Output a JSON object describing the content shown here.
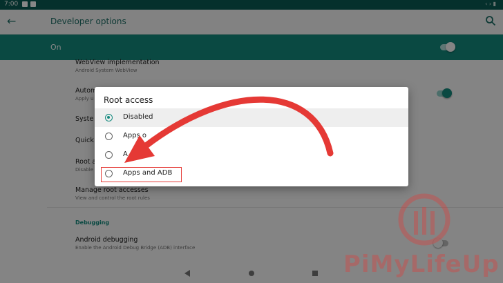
{
  "status_bar": {
    "time": "7:00"
  },
  "app_bar": {
    "title": "Developer options"
  },
  "master_switch": {
    "label": "On",
    "state": "on"
  },
  "settings": {
    "webview": {
      "title": "WebView implementation",
      "summary": "Android System WebView"
    },
    "auto": {
      "title": "Autom",
      "summary": "Apply u"
    },
    "system": {
      "title": "Syste"
    },
    "quick": {
      "title": "Quick"
    },
    "root": {
      "title": "Root a",
      "summary": "Disable"
    },
    "manage_root": {
      "title": "Manage root accesses",
      "summary": "View and control the root rules"
    },
    "debugging_header": "Debugging",
    "android_debugging": {
      "title": "Android debugging",
      "summary": "Enable the Android Debug Bridge (ADB) interface"
    }
  },
  "dialog": {
    "title": "Root access",
    "options": [
      {
        "label": "Disabled",
        "selected": true
      },
      {
        "label": "Apps o",
        "selected": false
      },
      {
        "label": "A",
        "selected": false
      },
      {
        "label": "Apps and ADB",
        "selected": false
      }
    ]
  },
  "watermark": {
    "text": "PiMyLifeUp"
  },
  "colors": {
    "accent": "#138a7e",
    "annotation": "#e53935",
    "dark_teal": "#0b5b53"
  }
}
